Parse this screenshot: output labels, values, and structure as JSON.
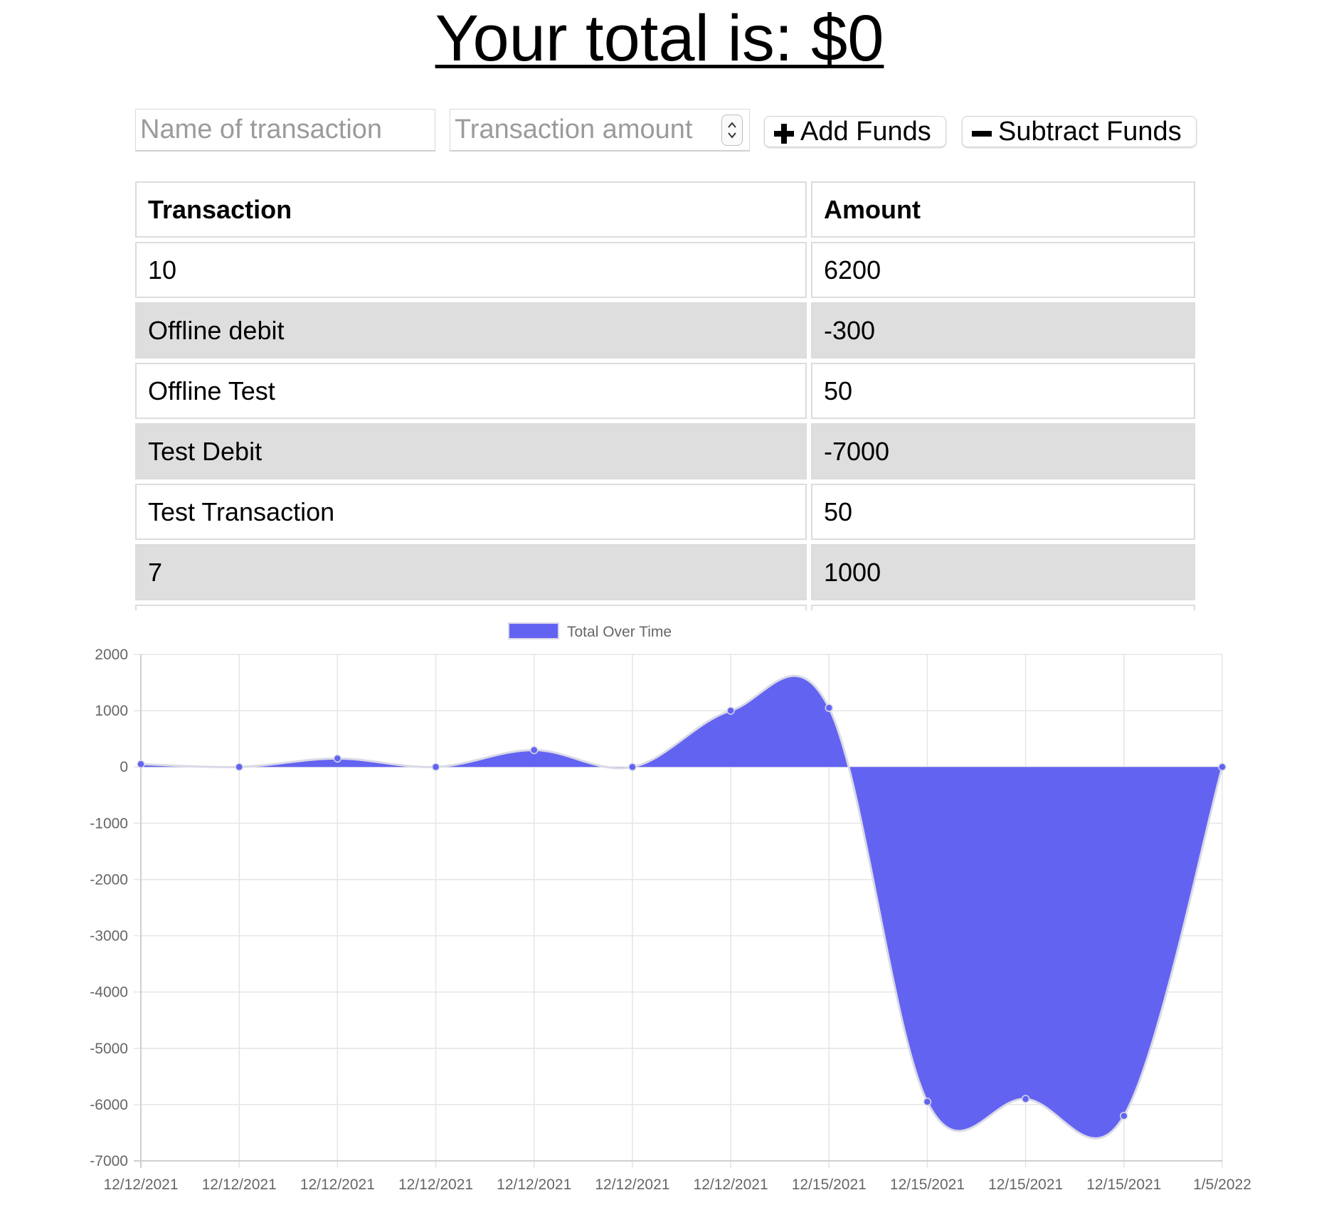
{
  "header": {
    "total_text": "Your total is: $0"
  },
  "form": {
    "name_placeholder": "Name of transaction",
    "amount_placeholder": "Transaction amount",
    "add_label": "Add Funds",
    "subtract_label": "Subtract Funds"
  },
  "table": {
    "headers": [
      "Transaction",
      "Amount"
    ],
    "rows": [
      [
        "10",
        "6200"
      ],
      [
        "Offline debit",
        "-300"
      ],
      [
        "Offline Test",
        "50"
      ],
      [
        "Test Debit",
        "-7000"
      ],
      [
        "Test Transaction",
        "50"
      ],
      [
        "7",
        "1000"
      ]
    ]
  },
  "colors": {
    "series_fill": "#6363f2",
    "series_stroke": "#d9d9e6",
    "row_alt": "#dedede",
    "grid": "#e5e5e5"
  },
  "chart_data": {
    "type": "area",
    "title": "",
    "legend": "top-center",
    "grid": true,
    "x": [
      "12/12/2021",
      "12/12/2021",
      "12/12/2021",
      "12/12/2021",
      "12/12/2021",
      "12/12/2021",
      "12/12/2021",
      "12/15/2021",
      "12/15/2021",
      "12/15/2021",
      "12/15/2021",
      "1/5/2022"
    ],
    "series": [
      {
        "name": "Total Over Time",
        "values": [
          50,
          0,
          150,
          0,
          300,
          0,
          1000,
          1050,
          -5950,
          -5900,
          -6200,
          0
        ]
      }
    ],
    "ylim": [
      -7000,
      2000
    ],
    "yticks": [
      2000,
      1000,
      0,
      -1000,
      -2000,
      -3000,
      -4000,
      -5000,
      -6000,
      -7000
    ]
  }
}
